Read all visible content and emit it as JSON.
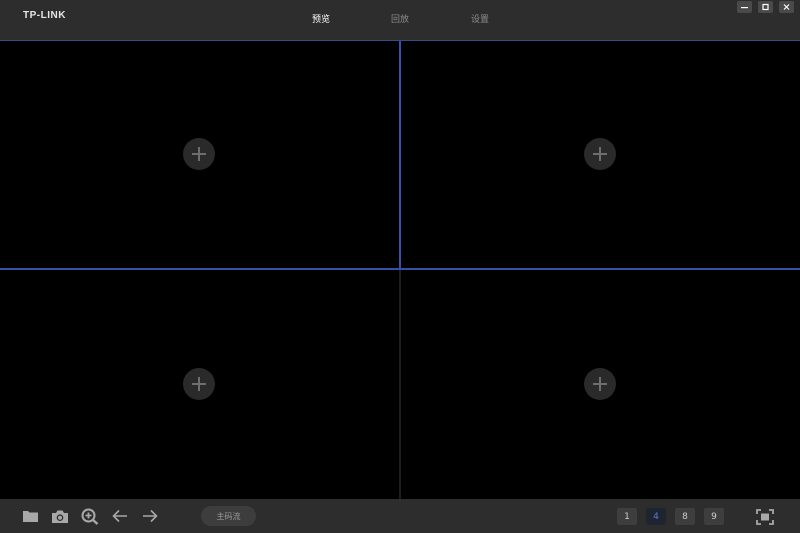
{
  "app": {
    "brand": "TP-LINK"
  },
  "nav": {
    "tabs": [
      {
        "label": "预览",
        "active": true
      },
      {
        "label": "回放",
        "active": false
      },
      {
        "label": "设置",
        "active": false
      }
    ]
  },
  "window_controls": {
    "minimize": "minimize-icon",
    "restore": "restore-icon",
    "close": "close-icon"
  },
  "grid": {
    "layout": 4,
    "cells": [
      {
        "icon": "add-camera-icon"
      },
      {
        "icon": "add-camera-icon"
      },
      {
        "icon": "add-camera-icon"
      },
      {
        "icon": "add-camera-icon"
      }
    ]
  },
  "toolbar": {
    "tools": [
      "folder-icon",
      "camera-icon",
      "zoom-in-icon",
      "arrow-left-icon",
      "arrow-right-icon"
    ],
    "stream_label": "主码流",
    "layouts": [
      "1",
      "4",
      "8",
      "9"
    ],
    "active_layout": "4",
    "fullscreen": "fullscreen-icon"
  },
  "colors": {
    "accent": "#3a4fa8",
    "bar": "#2d2d2d",
    "active_layout_text": "#5c7ad6"
  }
}
